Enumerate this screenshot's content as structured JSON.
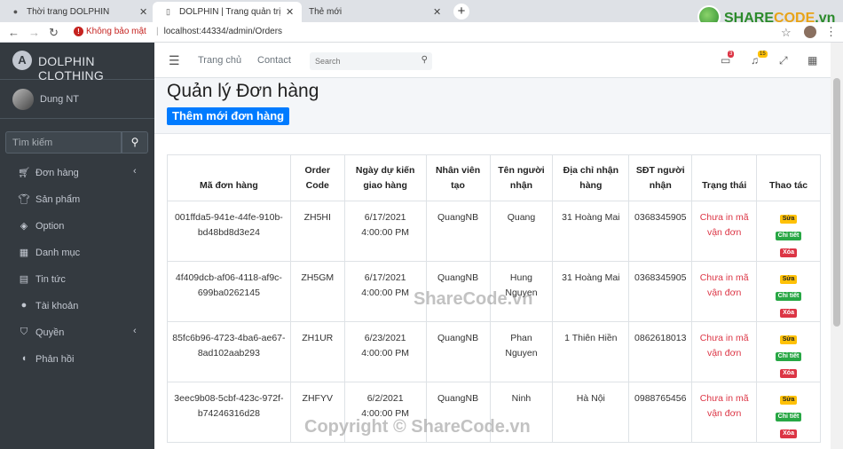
{
  "browser": {
    "tabs": [
      {
        "title": "Thời trang DOLPHIN"
      },
      {
        "title": "DOLPHIN | Trang quản trị"
      },
      {
        "title": "Thẻ mới"
      }
    ],
    "security_label": "Không bảo mật",
    "url": "localhost:44334/admin/Orders"
  },
  "watermark": {
    "logo_a": "SHARE",
    "logo_b": "CODE",
    "logo_c": ".vn",
    "center": "ShareCode.vn",
    "bottom": "Copyright © ShareCode.vn"
  },
  "sidebar": {
    "brand": "DOLPHIN CLOTHING",
    "user": "Dung NT",
    "search_placeholder": "Tìm kiếm",
    "items": [
      {
        "label": "Đơn hàng",
        "icon": "cart-icon"
      },
      {
        "label": "Sản phẩm",
        "icon": "shirt-icon"
      },
      {
        "label": "Option",
        "icon": "layers-icon"
      },
      {
        "label": "Danh mục",
        "icon": "grid-icon"
      },
      {
        "label": "Tin tức",
        "icon": "news-icon"
      },
      {
        "label": "Tài khoản",
        "icon": "user-icon"
      },
      {
        "label": "Quyền",
        "icon": "shield-icon"
      },
      {
        "label": "Phản hồi",
        "icon": "comment-icon"
      }
    ]
  },
  "topnav": {
    "home": "Trang chủ",
    "contact": "Contact",
    "search_placeholder": "Search",
    "messages_count": "3",
    "notifications_count": "15"
  },
  "page": {
    "title": "Quản lý Đơn hàng",
    "add_button": "Thêm mới đơn hàng"
  },
  "table": {
    "headers": [
      "Mã đơn hàng",
      "Order Code",
      "Ngày dự kiến giao hàng",
      "Nhân viên tạo",
      "Tên người nhận",
      "Địa chỉ nhận hàng",
      "SĐT người nhận",
      "Trạng thái",
      "Thao tác"
    ],
    "actions": {
      "edit": "Sửa",
      "detail": "Chi tiết",
      "delete": "Xóa"
    },
    "rows": [
      {
        "id": "001ffda5-941e-44fe-910b-bd48bd8d3e24",
        "code": "ZH5HI",
        "date": "6/17/2021",
        "time": "4:00:00 PM",
        "staff": "QuangNB",
        "name": "Quang",
        "address": "31 Hoàng Mai",
        "phone": "0368345905",
        "status": "Chưa in mã vận đơn"
      },
      {
        "id": "4f409dcb-af06-4118-af9c-699ba0262145",
        "code": "ZH5GM",
        "date": "6/17/2021",
        "time": "4:00:00 PM",
        "staff": "QuangNB",
        "name": "Hung Nguyen",
        "address": "31 Hoàng Mai",
        "phone": "0368345905",
        "status": "Chưa in mã vận đơn"
      },
      {
        "id": "85fc6b96-4723-4ba6-ae67-8ad102aab293",
        "code": "ZH1UR",
        "date": "6/23/2021",
        "time": "4:00:00 PM",
        "staff": "QuangNB",
        "name": "Phan Nguyen",
        "address": "1 Thiên Hiền",
        "phone": "0862618013",
        "status": "Chưa in mã vận đơn"
      },
      {
        "id": "3eec9b08-5cbf-423c-972f-b74246316d28",
        "code": "ZHFYV",
        "date": "6/2/2021",
        "time": "4:00:00 PM",
        "staff": "QuangNB",
        "name": "Ninh",
        "address": "Hà Nội",
        "phone": "0988765456",
        "status": "Chưa in mã vận đơn"
      }
    ]
  }
}
